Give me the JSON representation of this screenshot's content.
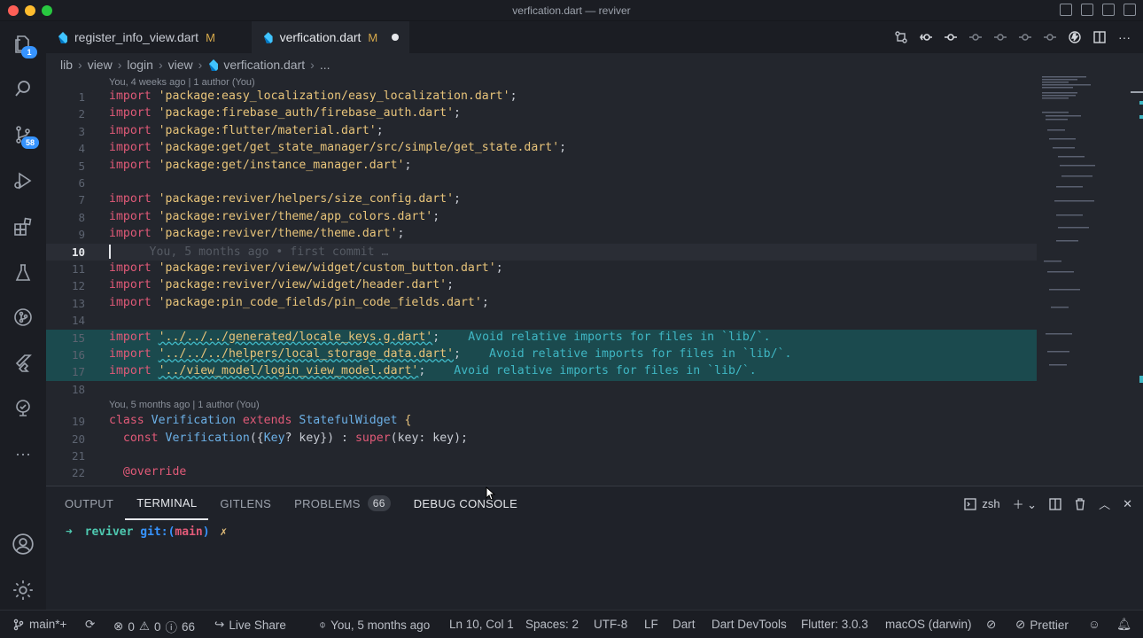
{
  "window": {
    "title": "verfication.dart — reviver"
  },
  "activity": {
    "explorer_badge": "1",
    "scm_badge": "58"
  },
  "tabs": [
    {
      "label": "register_info_view.dart",
      "status": "M"
    },
    {
      "label": "verfication.dart",
      "status": "M"
    }
  ],
  "breadcrumb": {
    "parts": [
      "lib",
      "view",
      "login",
      "view",
      "verfication.dart",
      "..."
    ]
  },
  "editor": {
    "blame_top": "You, 4 weeks ago | 1 author (You)",
    "blame_class": "You, 5 months ago | 1 author (You)",
    "ghost_blame": "You, 5 months ago • first commit …",
    "lines": [
      {
        "n": "1",
        "kw": "import ",
        "str": "'package:easy_localization/easy_localization.dart'",
        "end": ";"
      },
      {
        "n": "2",
        "kw": "import ",
        "str": "'package:firebase_auth/firebase_auth.dart'",
        "end": ";"
      },
      {
        "n": "3",
        "kw": "import ",
        "str": "'package:flutter/material.dart'",
        "end": ";"
      },
      {
        "n": "4",
        "kw": "import ",
        "str": "'package:get/get_state_manager/src/simple/get_state.dart'",
        "end": ";"
      },
      {
        "n": "5",
        "kw": "import ",
        "str": "'package:get/instance_manager.dart'",
        "end": ";"
      },
      {
        "n": "6",
        "kw": "",
        "str": "",
        "end": ""
      },
      {
        "n": "7",
        "kw": "import ",
        "str": "'package:reviver/helpers/size_config.dart'",
        "end": ";"
      },
      {
        "n": "8",
        "kw": "import ",
        "str": "'package:reviver/theme/app_colors.dart'",
        "end": ";"
      },
      {
        "n": "9",
        "kw": "import ",
        "str": "'package:reviver/theme/theme.dart'",
        "end": ";"
      },
      {
        "n": "10",
        "kw": "",
        "str": "",
        "end": ""
      },
      {
        "n": "11",
        "kw": "import ",
        "str": "'package:reviver/view/widget/custom_button.dart'",
        "end": ";"
      },
      {
        "n": "12",
        "kw": "import ",
        "str": "'package:reviver/view/widget/header.dart'",
        "end": ";"
      },
      {
        "n": "13",
        "kw": "import ",
        "str": "'package:pin_code_fields/pin_code_fields.dart'",
        "end": ";"
      },
      {
        "n": "14",
        "kw": "",
        "str": "",
        "end": ""
      },
      {
        "n": "15",
        "kw": "import ",
        "str": "'../../../generated/locale_keys.g.dart'",
        "end": ";",
        "warn": "Avoid relative imports for files in `lib/`."
      },
      {
        "n": "16",
        "kw": "import ",
        "str": "'../../../helpers/local_storage_data.dart'",
        "end": ";",
        "warn": "Avoid relative imports for files in `lib/`."
      },
      {
        "n": "17",
        "kw": "import ",
        "str": "'../view_model/login_view_model.dart'",
        "end": ";",
        "warn": "Avoid relative imports for files in `lib/`."
      },
      {
        "n": "18",
        "kw": "",
        "str": "",
        "end": ""
      }
    ],
    "class_line": {
      "n": "19",
      "kw1": "class ",
      "name": "Verification",
      "kw2": " extends ",
      "base": "StatefulWidget",
      "end": " {"
    },
    "ctor_line": {
      "n": "20",
      "kw": "  const ",
      "name": "Verification",
      "p1": "({",
      "type": "Key",
      "p2": "? key}) : ",
      "sup": "super",
      "p3": "(key: key);"
    },
    "line21": {
      "n": "21"
    },
    "override_line": {
      "n": "22",
      "text": "  @override"
    }
  },
  "panel": {
    "tabs": [
      "OUTPUT",
      "TERMINAL",
      "GITLENS",
      "PROBLEMS",
      "DEBUG CONSOLE"
    ],
    "problems_count": "66",
    "shell": "zsh",
    "prompt": {
      "arrow": "➜",
      "dir": "reviver",
      "git": "git:(",
      "branch": "main",
      ")": ")",
      "x": "✗"
    }
  },
  "status": {
    "branch": "main*+",
    "errors": "0",
    "warnings": "0",
    "infos": "66",
    "liveshare": "Live Share",
    "blame": "You, 5 months ago",
    "position": "Ln 10, Col 1",
    "spaces": "Spaces: 2",
    "encoding": "UTF-8",
    "eol": "LF",
    "language": "Dart",
    "devtools": "Dart DevTools",
    "flutter": "Flutter: 3.0.3",
    "device": "macOS (darwin)",
    "prettier": "Prettier"
  }
}
